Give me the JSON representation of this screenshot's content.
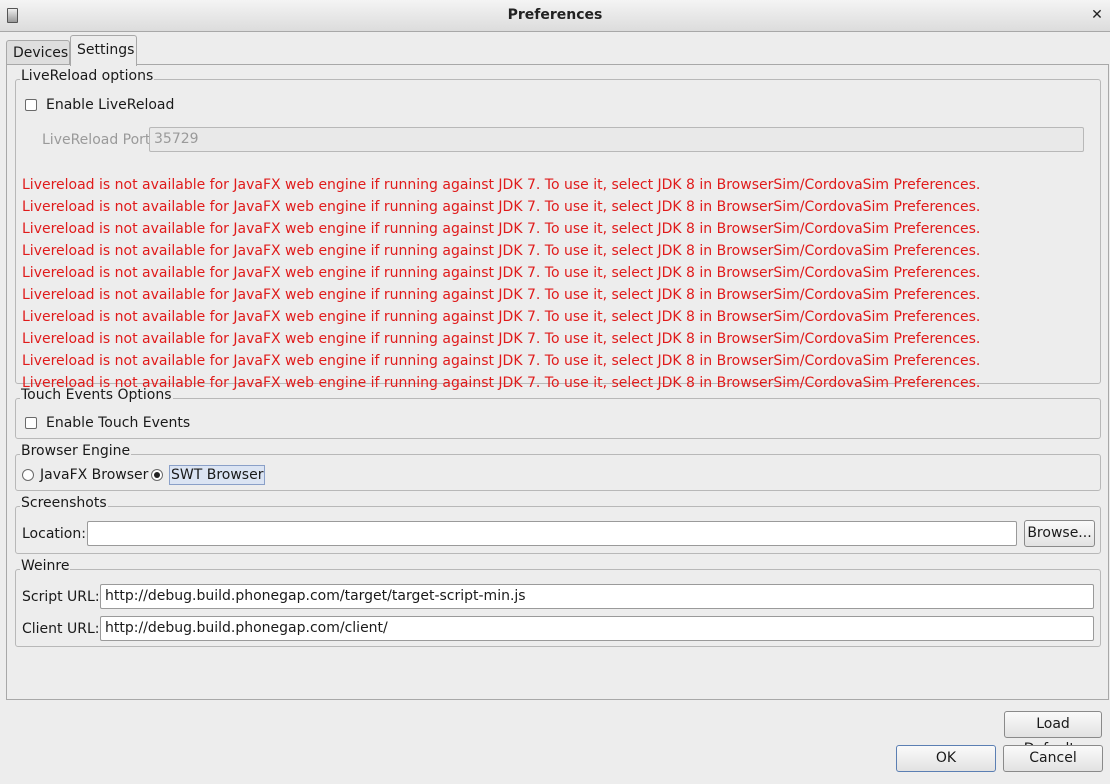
{
  "window": {
    "title": "Preferences"
  },
  "tabs": [
    {
      "label": "Devices",
      "active": false
    },
    {
      "label": "Settings",
      "active": true
    }
  ],
  "livereload": {
    "group_label": "LiveReload options",
    "enable_label": "Enable LiveReload",
    "enable_checked": false,
    "port_label": "LiveReload Port",
    "port_value": "35729",
    "warnings": [
      "Livereload is not available for JavaFX web engine if running against JDK 7. To use it, select JDK 8 in BrowserSim/CordovaSim Preferences.",
      "Livereload is not available for JavaFX web engine if running against JDK 7. To use it, select JDK 8 in BrowserSim/CordovaSim Preferences.",
      "Livereload is not available for JavaFX web engine if running against JDK 7. To use it, select JDK 8 in BrowserSim/CordovaSim Preferences.",
      "Livereload is not available for JavaFX web engine if running against JDK 7. To use it, select JDK 8 in BrowserSim/CordovaSim Preferences.",
      "Livereload is not available for JavaFX web engine if running against JDK 7. To use it, select JDK 8 in BrowserSim/CordovaSim Preferences.",
      "Livereload is not available for JavaFX web engine if running against JDK 7. To use it, select JDK 8 in BrowserSim/CordovaSim Preferences.",
      "Livereload is not available for JavaFX web engine if running against JDK 7. To use it, select JDK 8 in BrowserSim/CordovaSim Preferences.",
      "Livereload is not available for JavaFX web engine if running against JDK 7. To use it, select JDK 8 in BrowserSim/CordovaSim Preferences.",
      "Livereload is not available for JavaFX web engine if running against JDK 7. To use it, select JDK 8 in BrowserSim/CordovaSim Preferences.",
      "Livereload is not available for JavaFX web engine if running against JDK 7. To use it, select JDK 8 in BrowserSim/CordovaSim Preferences."
    ],
    "warning_color": "#e01b1b"
  },
  "touch": {
    "group_label": "Touch Events Options",
    "enable_label": "Enable Touch Events",
    "enable_checked": false
  },
  "engine": {
    "group_label": "Browser Engine",
    "options": [
      {
        "label": "JavaFX Browser",
        "selected": false
      },
      {
        "label": "SWT Browser",
        "selected": true
      }
    ]
  },
  "screenshots": {
    "group_label": "Screenshots",
    "location_label": "Location:",
    "location_value": "",
    "browse_label": "Browse..."
  },
  "weinre": {
    "group_label": "Weinre",
    "script_label": "Script URL:",
    "script_value": "http://debug.build.phonegap.com/target/target-script-min.js",
    "client_label": "Client URL:",
    "client_value": "http://debug.build.phonegap.com/client/"
  },
  "buttons": {
    "load_defaults": "Load Defaults",
    "ok": "OK",
    "cancel": "Cancel"
  },
  "icons": {
    "close": "close-icon",
    "app": "app-icon"
  }
}
